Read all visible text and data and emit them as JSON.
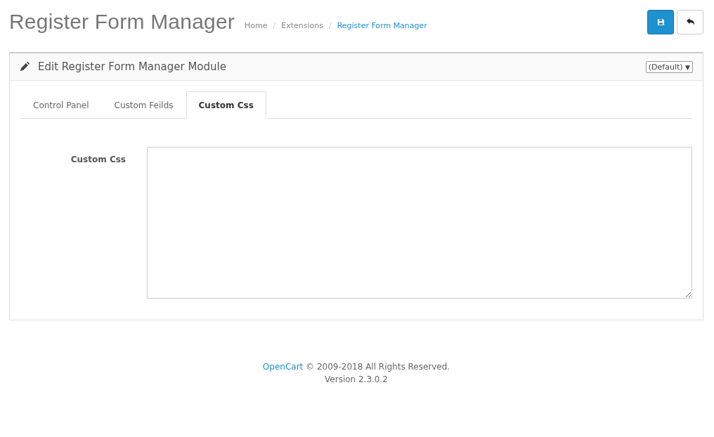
{
  "page_title": "Register Form Manager",
  "breadcrumb": {
    "separator": "/",
    "items": [
      {
        "label": "Home",
        "current": false
      },
      {
        "label": "Extensions",
        "current": false
      },
      {
        "label": "Register Form Manager",
        "current": true
      }
    ]
  },
  "panel": {
    "title": "Edit Register Form Manager Module",
    "store_select": {
      "value": "(Default)",
      "caret": "▼"
    }
  },
  "tabs": [
    {
      "label": "Control Panel",
      "selected": false
    },
    {
      "label": "Custom Feilds",
      "selected": false
    },
    {
      "label": "Custom Css",
      "selected": true
    }
  ],
  "form": {
    "label": "Custom Css"
  },
  "footer": {
    "link": "OpenCart",
    "text": "© 2009-2018 All Rights Reserved.",
    "version": "Version 2.3.0.2"
  }
}
